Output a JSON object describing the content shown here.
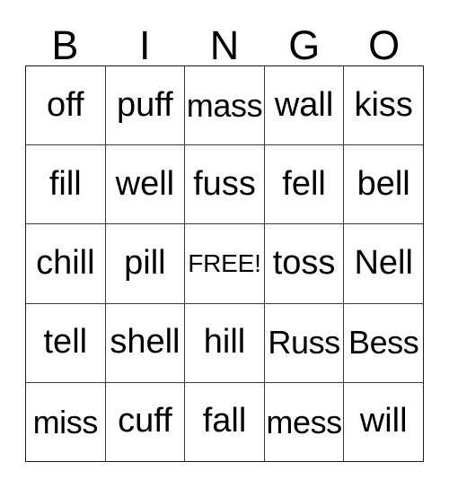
{
  "card": {
    "type": "bingo-card",
    "columns": 5,
    "rows": 5,
    "background_color": "#ffffff",
    "text_color": "#000000",
    "grid_line_color": "#3c3c3c",
    "border_color": "#1a1a1a"
  },
  "header": {
    "letters": [
      "B",
      "I",
      "N",
      "G",
      "O"
    ]
  },
  "grid": {
    "rows": [
      {
        "cells": [
          {
            "text": "off"
          },
          {
            "text": "puff"
          },
          {
            "text": "mass"
          },
          {
            "text": "wall"
          },
          {
            "text": "kiss"
          }
        ]
      },
      {
        "cells": [
          {
            "text": "fill"
          },
          {
            "text": "well"
          },
          {
            "text": "fuss"
          },
          {
            "text": "fell"
          },
          {
            "text": "bell"
          }
        ]
      },
      {
        "cells": [
          {
            "text": "chill"
          },
          {
            "text": "pill"
          },
          {
            "text": "FREE!"
          },
          {
            "text": "toss"
          },
          {
            "text": "Nell"
          }
        ]
      },
      {
        "cells": [
          {
            "text": "tell"
          },
          {
            "text": "shell"
          },
          {
            "text": "hill"
          },
          {
            "text": "Russ"
          },
          {
            "text": "Bess"
          }
        ]
      },
      {
        "cells": [
          {
            "text": "miss"
          },
          {
            "text": "cuff"
          },
          {
            "text": "fall"
          },
          {
            "text": "mess"
          },
          {
            "text": "will"
          }
        ]
      }
    ]
  }
}
